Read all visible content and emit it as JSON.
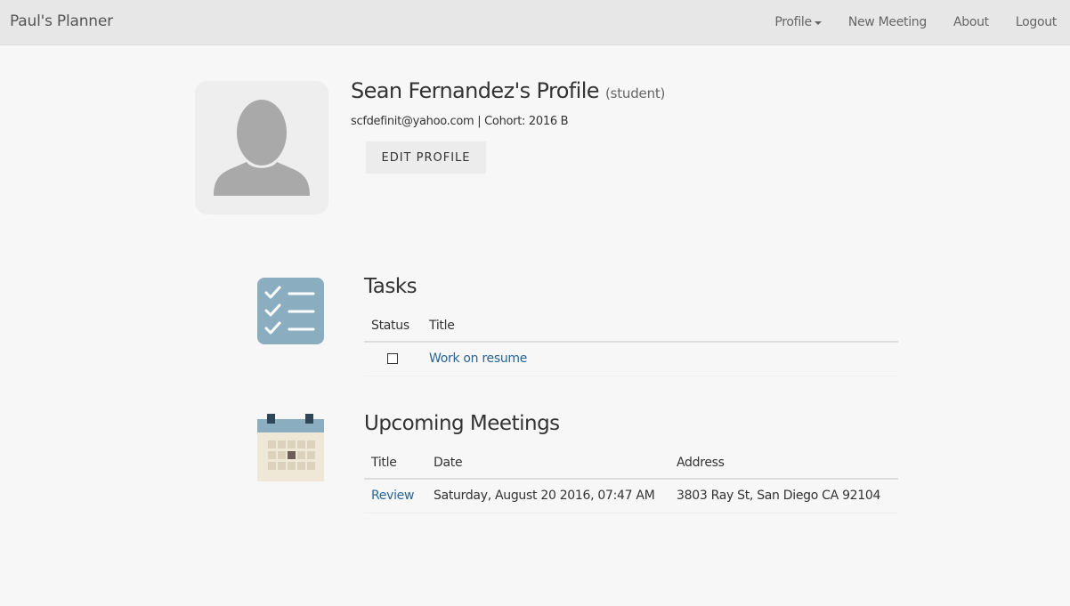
{
  "navbar": {
    "brand": "Paul's Planner",
    "links": {
      "profile": "Profile",
      "new_meeting": "New Meeting",
      "about": "About",
      "logout": "Logout"
    }
  },
  "profile": {
    "name": "Sean Fernandez's Profile",
    "role": "(student)",
    "email": "scfdefinit@yahoo.com",
    "separator": "|",
    "cohort": "Cohort: 2016 B",
    "edit_button": "EDIT PROFILE",
    "avatar_icon": "user-silhouette-icon"
  },
  "tasks": {
    "title": "Tasks",
    "icon": "checklist-icon",
    "columns": [
      "Status",
      "Title"
    ],
    "rows": [
      {
        "status": "unchecked",
        "title": "Work on resume"
      }
    ]
  },
  "meetings": {
    "title": "Upcoming Meetings",
    "icon": "calendar-icon",
    "columns": [
      "Title",
      "Date",
      "Address"
    ],
    "rows": [
      {
        "title": "Review",
        "date": "Saturday, August 20 2016, 07:47 AM",
        "address": "3803 Ray St, San Diego CA 92104"
      }
    ]
  },
  "colors": {
    "navbar_bg": "#e7e7e7",
    "page_bg": "#f7f7f8",
    "link": "#2a6496",
    "checklist_icon": "#8aaec0",
    "calendar_header": "#8aaec0",
    "calendar_body": "#efe8d6"
  }
}
